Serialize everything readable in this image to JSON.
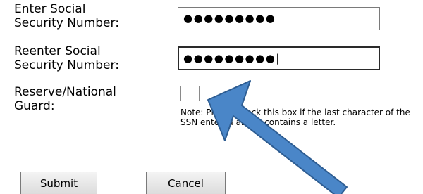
{
  "form": {
    "ssn_label": "Enter Social\nSecurity Number:",
    "ssn_value": "●●●●●●●●●",
    "ssn_confirm_label": "Reenter Social\nSecurity Number:",
    "ssn_confirm_value": "●●●●●●●●●|",
    "reserve_label": "Reserve/National\nGuard:",
    "reserve_checked": false,
    "note_text": "Note: Please check this box if the last character of the SSN entered above contains a letter."
  },
  "buttons": {
    "submit_label": "Submit",
    "cancel_label": "Cancel"
  },
  "overlay": {
    "arrow_color": "#4a86c8",
    "arrow_outline": "#2e5d92",
    "icon": "arrow-icon"
  }
}
